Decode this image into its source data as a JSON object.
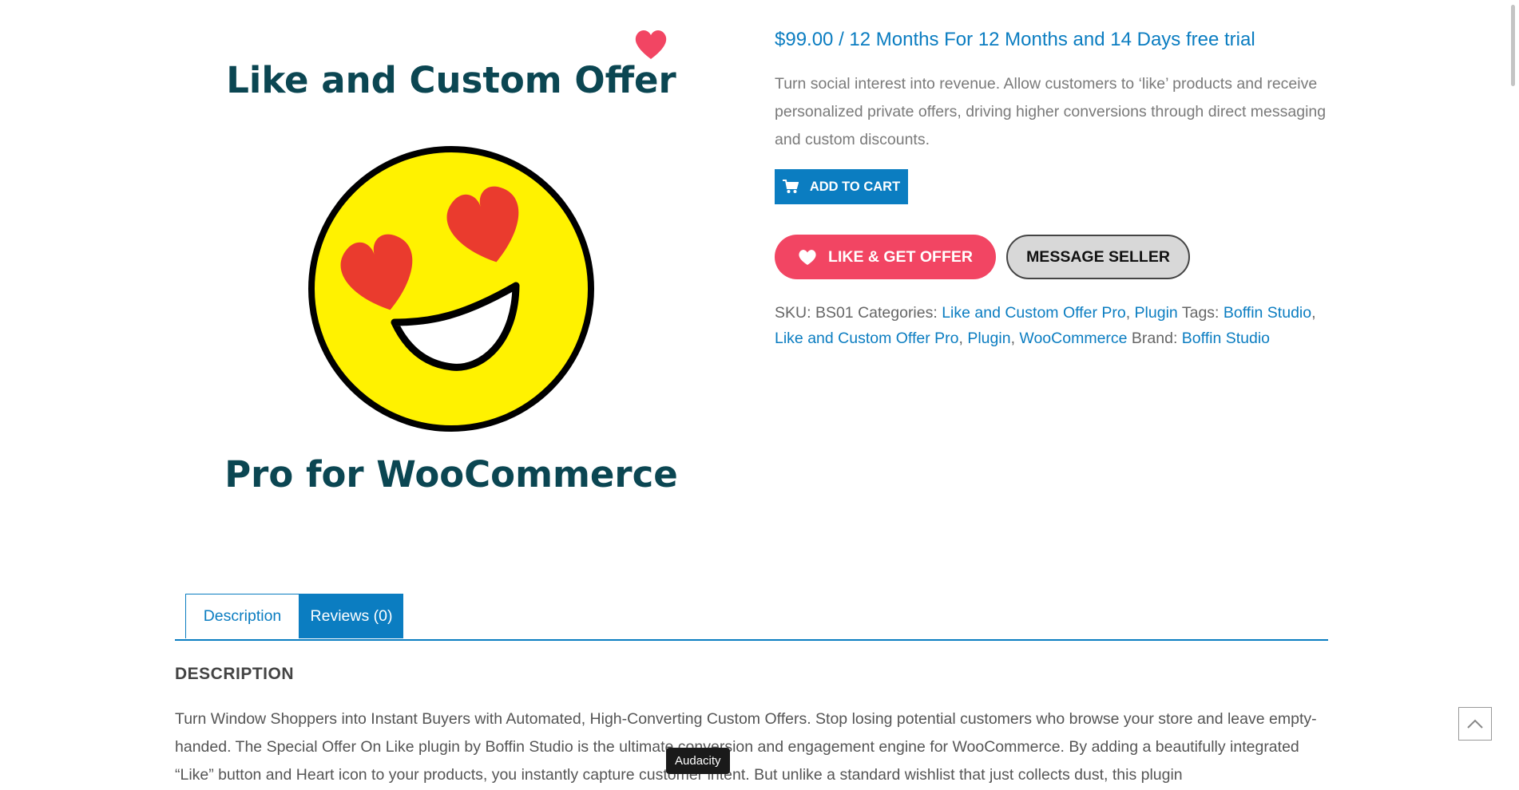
{
  "product": {
    "image_title_line1": "Like and Custom Offer",
    "image_title_line2": "Pro for WooCommerce",
    "price": "$99.00 / 12 Months For 12 Months and 14 Days free trial",
    "short_description": "Turn social interest into revenue. Allow customers to ‘like’ products and receive personalized private offers, driving higher conversions through direct messaging and custom discounts.",
    "add_to_cart_label": "ADD TO CART",
    "like_offer_label": "LIKE & GET OFFER",
    "message_seller_label": "MESSAGE SELLER"
  },
  "meta": {
    "sku_label": "SKU:",
    "sku_value": "BS01",
    "categories_label": "Categories:",
    "categories": [
      "Like and Custom Offer Pro",
      "Plugin"
    ],
    "tags_label": "Tags:",
    "tags": [
      "Boffin Studio",
      "Like and Custom Offer Pro",
      "Plugin",
      "WooCommerce"
    ],
    "brand_label": "Brand:",
    "brand": "Boffin Studio"
  },
  "tabs": {
    "description": "Description",
    "reviews": "Reviews (0)"
  },
  "description": {
    "heading": "DESCRIPTION",
    "body": "Turn Window Shoppers into Instant Buyers with Automated, High-Converting Custom Offers. Stop losing potential customers who browse your store and leave empty-handed. The Special Offer On Like plugin by Boffin Studio is the ultimate conversion and engagement engine for WooCommerce. By adding a beautifully integrated “Like” button and Heart icon to your products, you instantly capture customer intent. But unlike a standard wishlist that just collects dust, this plugin"
  },
  "tooltip": "Audacity",
  "colors": {
    "accent": "#0b7dc1",
    "like": "#f24563",
    "heading_dark": "#0b4652"
  },
  "icons": {
    "wish": "heart-icon",
    "cart": "cart-icon",
    "like": "heart-icon",
    "scroll_top": "chevron-up-icon"
  }
}
